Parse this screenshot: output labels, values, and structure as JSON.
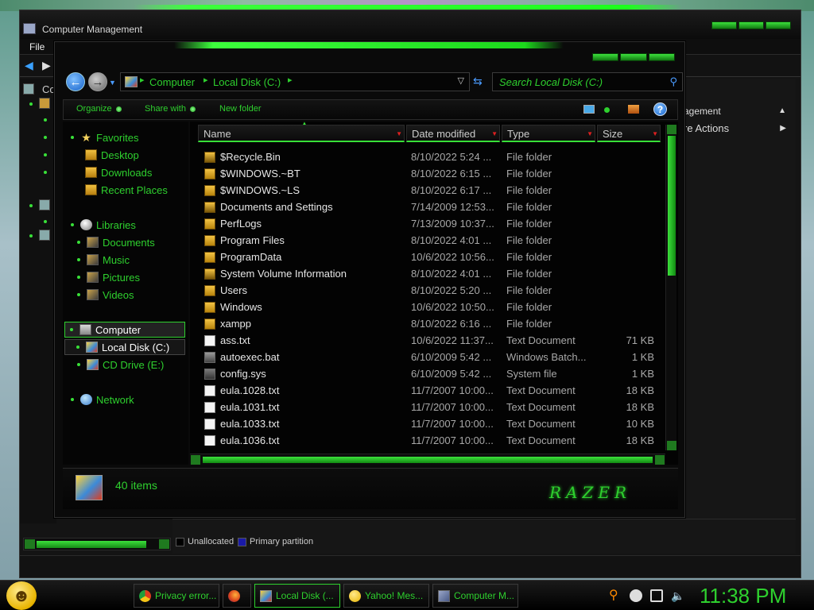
{
  "computer_management": {
    "title": "Computer Management",
    "menu": [
      "File"
    ],
    "tree_partial_label": "Co",
    "actions": {
      "header_partial": "agement",
      "more_actions_partial": "re Actions"
    },
    "legend": [
      {
        "label": "Unallocated",
        "color": "#000000"
      },
      {
        "label": "Primary partition",
        "color": "#1a1aa8"
      }
    ]
  },
  "explorer": {
    "breadcrumb": [
      "Computer",
      "Local Disk (C:)"
    ],
    "search_placeholder": "Search Local Disk (C:)",
    "toolbar": {
      "organize": "Organize",
      "share_with": "Share with",
      "new_folder": "New folder"
    },
    "nav": {
      "favorites": "Favorites",
      "desktop": "Desktop",
      "downloads": "Downloads",
      "recent_places": "Recent Places",
      "libraries": "Libraries",
      "documents": "Documents",
      "music": "Music",
      "pictures": "Pictures",
      "videos": "Videos",
      "computer": "Computer",
      "local_disk": "Local Disk (C:)",
      "cd_drive": "CD Drive (E:)",
      "network": "Network"
    },
    "columns": {
      "name": "Name",
      "date_modified": "Date modified",
      "type": "Type",
      "size": "Size"
    },
    "files": [
      {
        "name": "$Recycle.Bin",
        "date": "8/10/2022 5:24 ...",
        "type": "File folder",
        "size": "",
        "icon": "folder-lock"
      },
      {
        "name": "$WINDOWS.~BT",
        "date": "8/10/2022 6:15 ...",
        "type": "File folder",
        "size": "",
        "icon": "folder"
      },
      {
        "name": "$WINDOWS.~LS",
        "date": "8/10/2022 6:17 ...",
        "type": "File folder",
        "size": "",
        "icon": "folder"
      },
      {
        "name": "Documents and Settings",
        "date": "7/14/2009 12:53...",
        "type": "File folder",
        "size": "",
        "icon": "folder-lock"
      },
      {
        "name": "PerfLogs",
        "date": "7/13/2009 10:37...",
        "type": "File folder",
        "size": "",
        "icon": "folder"
      },
      {
        "name": "Program Files",
        "date": "8/10/2022 4:01 ...",
        "type": "File folder",
        "size": "",
        "icon": "folder"
      },
      {
        "name": "ProgramData",
        "date": "10/6/2022 10:56...",
        "type": "File folder",
        "size": "",
        "icon": "folder"
      },
      {
        "name": "System Volume Information",
        "date": "8/10/2022 4:01 ...",
        "type": "File folder",
        "size": "",
        "icon": "folder-lock"
      },
      {
        "name": "Users",
        "date": "8/10/2022 5:20 ...",
        "type": "File folder",
        "size": "",
        "icon": "folder"
      },
      {
        "name": "Windows",
        "date": "10/6/2022 10:50...",
        "type": "File folder",
        "size": "",
        "icon": "folder"
      },
      {
        "name": "xampp",
        "date": "8/10/2022 6:16 ...",
        "type": "File folder",
        "size": "",
        "icon": "folder"
      },
      {
        "name": "ass.txt",
        "date": "10/6/2022 11:37...",
        "type": "Text Document",
        "size": "71 KB",
        "icon": "txt"
      },
      {
        "name": "autoexec.bat",
        "date": "6/10/2009 5:42 ...",
        "type": "Windows Batch...",
        "size": "1 KB",
        "icon": "bat"
      },
      {
        "name": "config.sys",
        "date": "6/10/2009 5:42 ...",
        "type": "System file",
        "size": "1 KB",
        "icon": "sys"
      },
      {
        "name": "eula.1028.txt",
        "date": "11/7/2007 10:00...",
        "type": "Text Document",
        "size": "18 KB",
        "icon": "txt"
      },
      {
        "name": "eula.1031.txt",
        "date": "11/7/2007 10:00...",
        "type": "Text Document",
        "size": "18 KB",
        "icon": "txt"
      },
      {
        "name": "eula.1033.txt",
        "date": "11/7/2007 10:00...",
        "type": "Text Document",
        "size": "10 KB",
        "icon": "txt"
      },
      {
        "name": "eula.1036.txt",
        "date": "11/7/2007 10:00...",
        "type": "Text Document",
        "size": "18 KB",
        "icon": "txt"
      }
    ],
    "details": {
      "item_count": "40 items",
      "brand": "RAZER"
    }
  },
  "taskbar": {
    "buttons": [
      {
        "label": "Privacy error...",
        "icon": "chrome-icon",
        "active": false
      },
      {
        "label": "",
        "icon": "firefox-icon",
        "active": false
      },
      {
        "label": "Local Disk (...",
        "icon": "disk-icon",
        "active": true
      },
      {
        "label": "Yahoo! Mes...",
        "icon": "yahoo-icon",
        "active": false
      },
      {
        "label": "Computer M...",
        "icon": "computer-management-icon",
        "active": false
      }
    ],
    "clock": "11:38 PM"
  },
  "colors": {
    "accent_green": "#2ed02e",
    "bright_green": "#3ce03c",
    "sort_red": "#e02020",
    "background": "#0a0a0a"
  }
}
